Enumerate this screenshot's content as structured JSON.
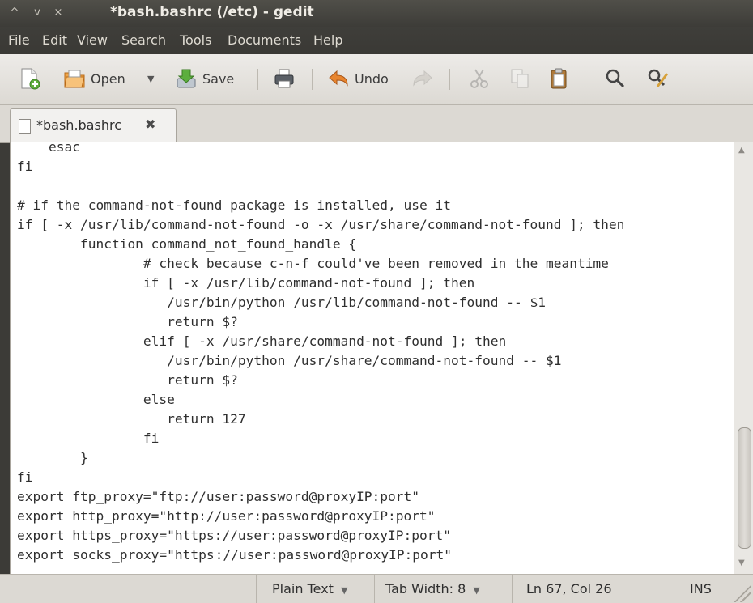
{
  "window": {
    "title": "*bash.bashrc (/etc) - gedit",
    "controls": [
      "^",
      "v",
      "×"
    ]
  },
  "menu": [
    "File",
    "Edit",
    "View",
    "Search",
    "Tools",
    "Documents",
    "Help"
  ],
  "toolbar": {
    "open_label": "Open",
    "save_label": "Save",
    "undo_label": "Undo"
  },
  "tab": {
    "label": "*bash.bashrc",
    "close": "✖"
  },
  "editor": {
    "lines": [
      "    esac",
      "fi",
      "",
      "# if the command-not-found package is installed, use it",
      "if [ -x /usr/lib/command-not-found -o -x /usr/share/command-not-found ]; then",
      "        function command_not_found_handle {",
      "                # check because c-n-f could've been removed in the meantime",
      "                if [ -x /usr/lib/command-not-found ]; then",
      "                   /usr/bin/python /usr/lib/command-not-found -- $1",
      "                   return $?",
      "                elif [ -x /usr/share/command-not-found ]; then",
      "                   /usr/bin/python /usr/share/command-not-found -- $1",
      "                   return $?",
      "                else",
      "                   return 127",
      "                fi",
      "        }",
      "fi",
      "export ftp_proxy=\"ftp://user:password@proxyIP:port\"",
      "export http_proxy=\"http://user:password@proxyIP:port\"",
      "export https_proxy=\"https://user:password@proxyIP:port\""
    ],
    "last_line_before_cursor": "export socks_proxy=\"https",
    "last_line_after_cursor": "://user:password@proxyIP:port\""
  },
  "status": {
    "language": "Plain Text",
    "tab_width": "Tab Width: 8",
    "position": "Ln 67, Col 26",
    "mode": "INS",
    "dropdown_arrow": "▼"
  },
  "colors": {
    "titlebar": "#3c3b37",
    "editor_bg": "#ffffff",
    "chrome": "#dcd9d3"
  }
}
